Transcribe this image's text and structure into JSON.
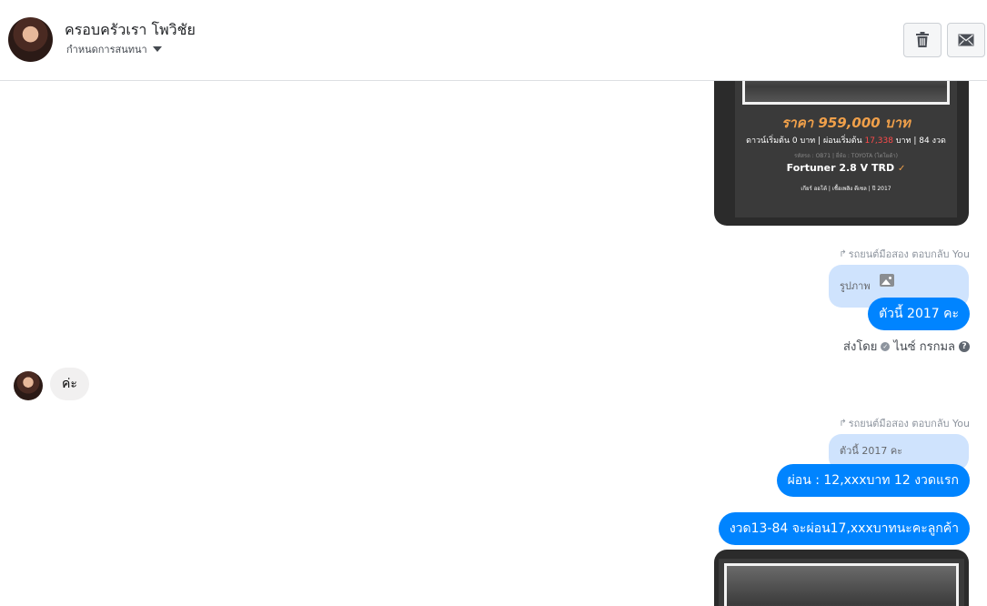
{
  "header": {
    "contact_name": "ครอบครัวเรา โพวิชัย",
    "conversation_settings_label": "กำหนดการสนทนา",
    "delete_icon": "trash-icon",
    "mail_icon": "envelope-icon"
  },
  "messages": {
    "card_top": {
      "price": "ราคา 959,000 บาท",
      "down_prefix": "ดาวน์เริ่มต้น 0 บาท | ผ่อนเริ่มต้น ",
      "down_highlight": "17,338",
      "down_suffix": " บาท | 84 งวด",
      "tags": "รหัสรถ : OB71 | ยี่ห้อ : TOYOTA (โตโยต้า)",
      "model": "Fortuner 2.8 V TRD",
      "specs": "เกียร์ ออโต้ | เชื้อเพลิง ดีเซล | ปี 2017"
    },
    "reply_1": {
      "meta": "รถยนต์มือสอง ตอบกลับ You",
      "quoted_text": "รูปภาพ",
      "quoted_icon": "image-icon",
      "message": "ตัวนี้ 2017 คะ"
    },
    "sent_by": {
      "prefix": "ส่งโดย",
      "name": "ไนซ์ กรกมล",
      "help_icon": "question-icon"
    },
    "incoming_1": "ค่ะ",
    "reply_2": {
      "meta": "รถยนต์มือสอง ตอบกลับ You",
      "quoted_text": "ตัวนี้ 2017 คะ",
      "message": "ผ่อน : 12,xxxบาท 12 งวดแรก"
    },
    "outgoing_3": "งวด13-84 จะผ่อน17,xxxบาทนะคะลูกค้า"
  },
  "colors": {
    "accent": "#0084ff",
    "quote_bg": "#cfe3fd",
    "incoming_bg": "#f1f0f0",
    "card_bg": "#2b2b2b",
    "price_color": "#f0a04a"
  }
}
